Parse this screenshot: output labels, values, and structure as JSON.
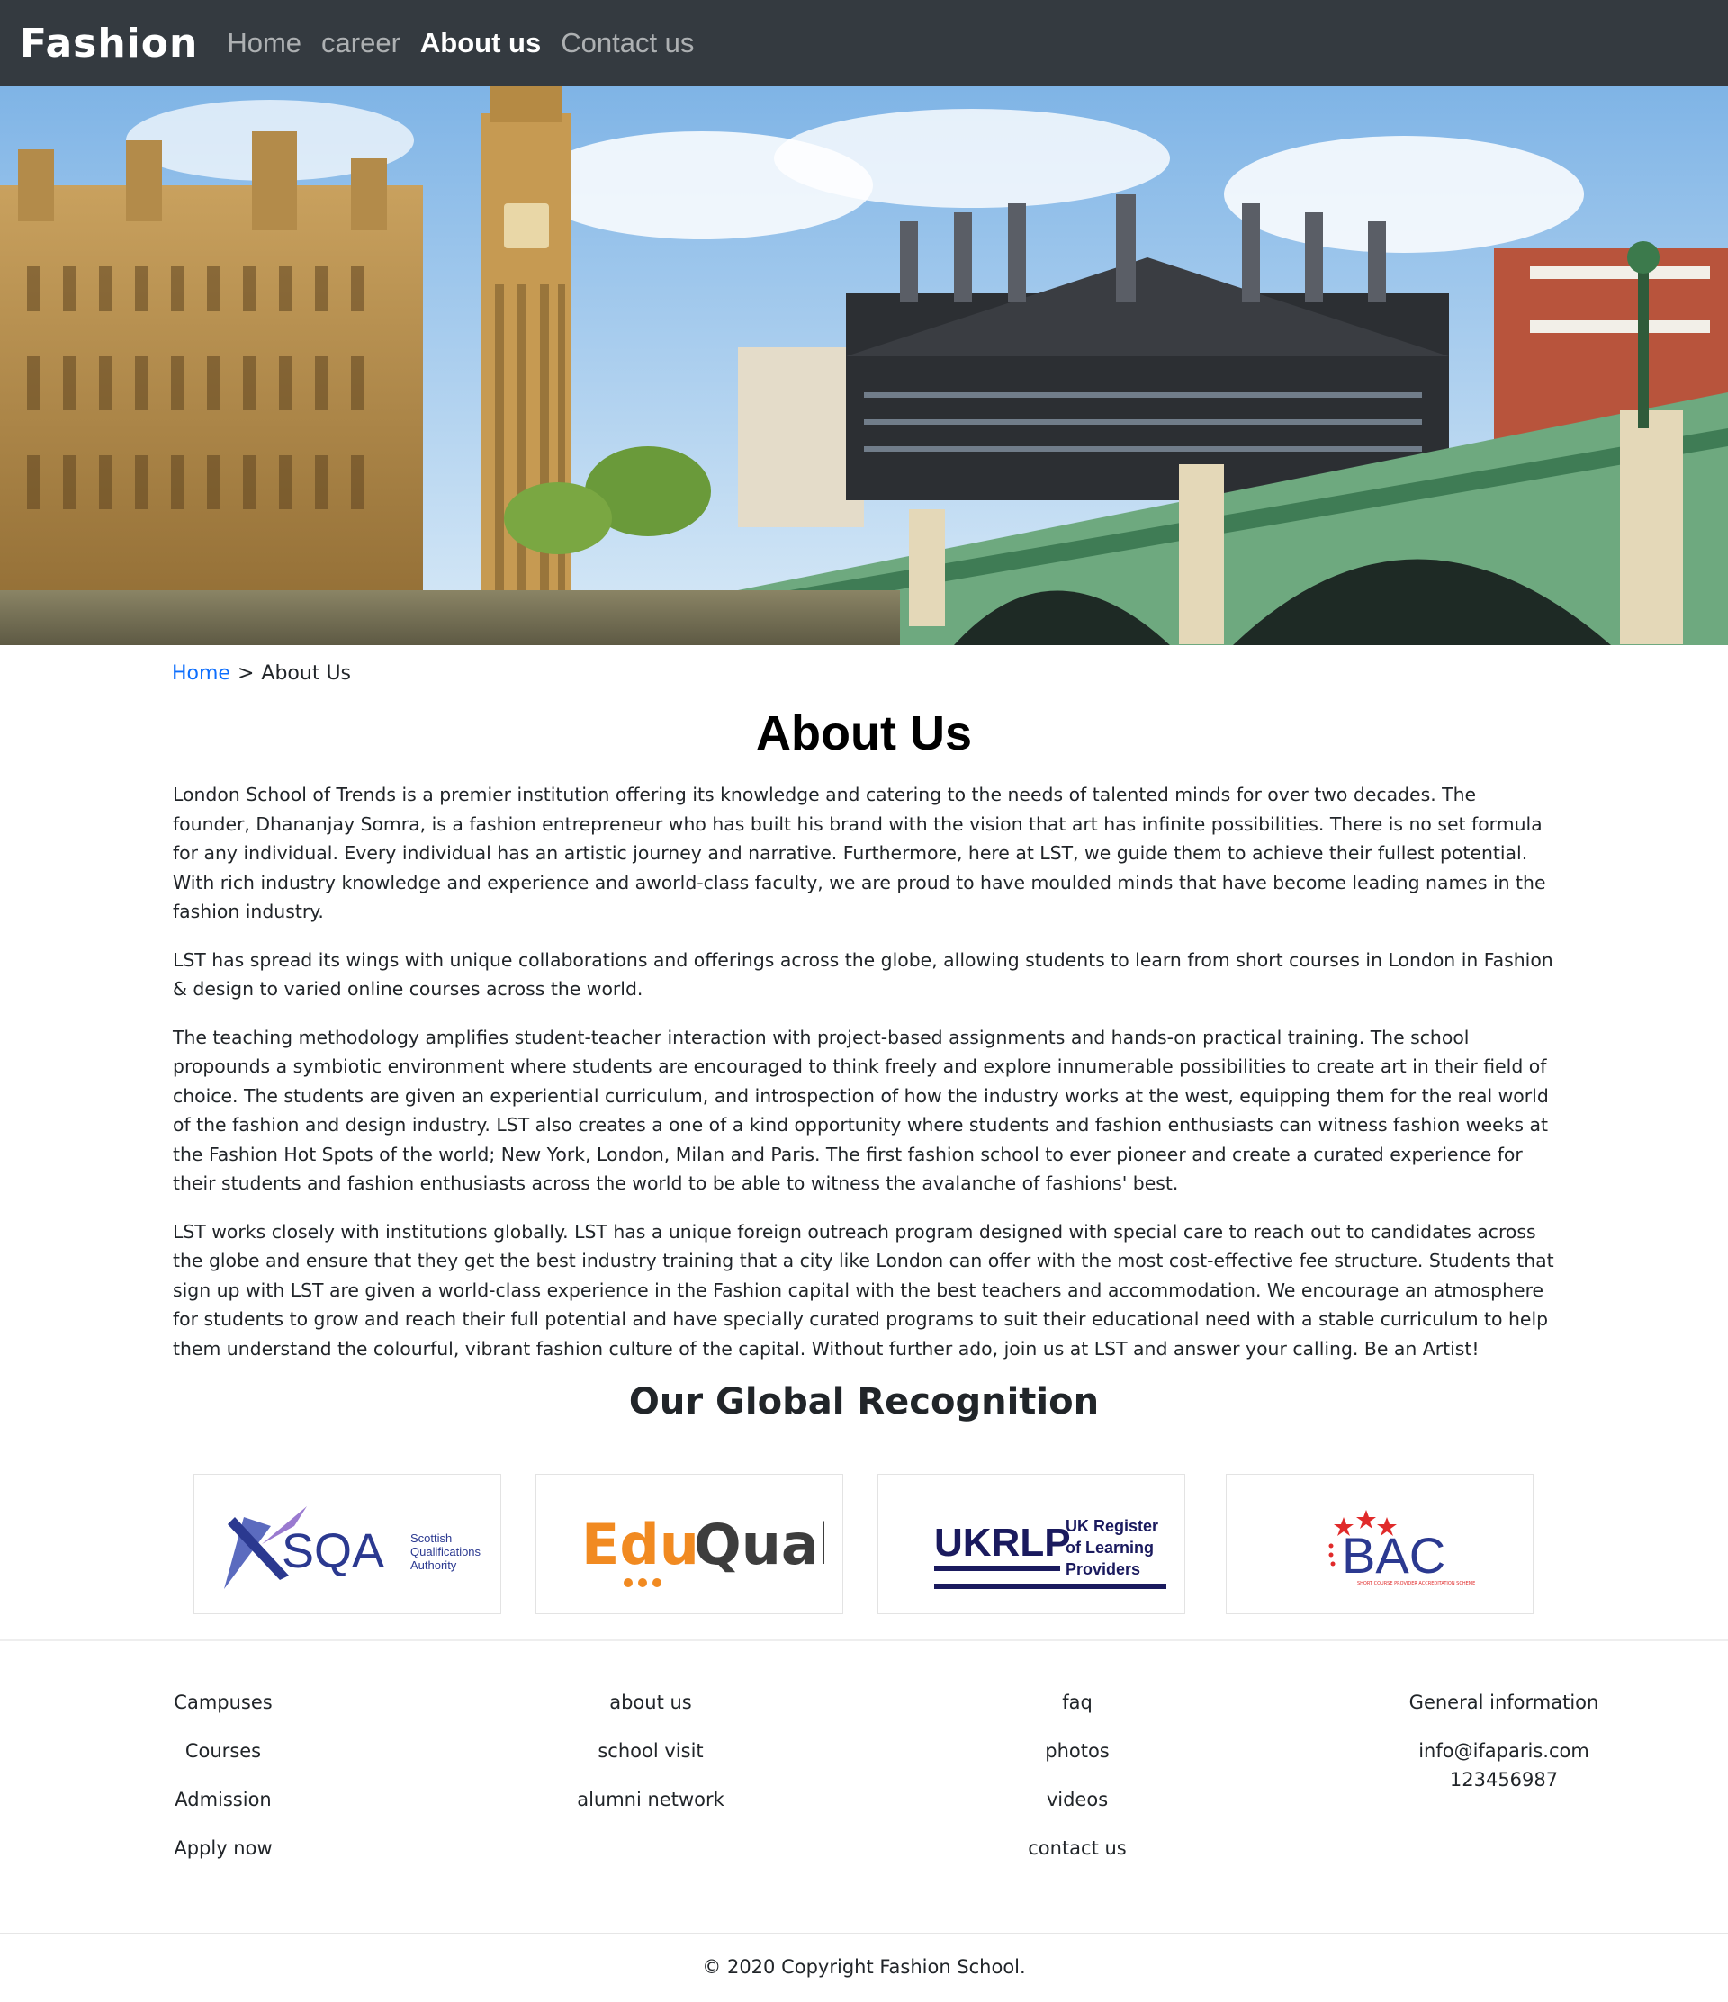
{
  "navbar": {
    "brand": "Fashion",
    "links": [
      "Home",
      "career",
      "About us",
      "Contact us"
    ],
    "active": "About us"
  },
  "breadcrumb": {
    "home": "Home",
    "separator": ">",
    "current": "About Us"
  },
  "page": {
    "title": "About Us",
    "paragraphs": [
      "London School of Trends is a premier institution offering its knowledge and catering to the needs of talented minds for over two decades. The founder, Dhananjay Somra, is a fashion entrepreneur who has built his brand with the vision that art has infinite possibilities. There is no set formula for any individual. Every individual has an artistic journey and narrative. Furthermore, here at LST, we guide them to achieve their fullest potential. With rich industry knowledge and experience and aworld-class faculty, we are proud to have moulded minds that have become leading names in the fashion industry.",
      "LST has spread its wings with unique collaborations and offerings across the globe, allowing students to learn from short courses in London in Fashion & design to varied online courses across the world.",
      "The teaching methodology amplifies student-teacher interaction with project-based assignments and hands-on practical training. The school propounds a symbiotic environment where students are encouraged to think freely and explore innumerable possibilities to create art in their field of choice. The students are given an experiential curriculum, and introspection of how the industry works at the west, equipping them for the real world of the fashion and design industry. LST also creates a one of a kind opportunity where students and fashion enthusiasts can witness fashion weeks at the Fashion Hot Spots of the world; New York, London, Milan and Paris. The first fashion school to ever pioneer and create a curated experience for their students and fashion enthusiasts across the world to be able to witness the avalanche of fashions' best.",
      "LST works closely with institutions globally. LST has a unique foreign outreach program designed with special care to reach out to candidates across the globe and ensure that they get the best industry training that a city like London can offer with the most cost-effective fee structure. Students that sign up with LST are given a world-class experience in the Fashion capital with the best teachers and accommodation. We encourage an atmosphere for students to grow and reach their full potential and have specially curated programs to suit their educational need with a stable curriculum to help them understand the colourful, vibrant fashion culture of the capital. Without further ado, join us at LST and answer your calling. Be an Artist!"
    ]
  },
  "recognition": {
    "title": "Our Global Recognition",
    "logos": {
      "sqa": {
        "mark": "SQA",
        "text1": "Scottish",
        "text2": "Qualifications",
        "text3": "Authority"
      },
      "eduqual": {
        "part1": "Edu",
        "part2": "Qual"
      },
      "ukrlp": {
        "mark": "UKRLP",
        "text1": "UK Register",
        "text2": "of Learning",
        "text3": "Providers"
      },
      "bac": {
        "mark": "BAC",
        "subtext": "SHORT COURSE PROVIDER ACCREDITATION SCHEME"
      }
    }
  },
  "footer": {
    "col1": [
      "Campuses",
      "Courses",
      "Admission",
      "Apply now"
    ],
    "col2": [
      "about us",
      "school visit",
      "alumni network"
    ],
    "col3": [
      "faq",
      "photos",
      "videos",
      "contact us"
    ],
    "col4": {
      "title": "General information",
      "email": "info@ifaparis.com",
      "phone": "123456987"
    },
    "copyright": "© 2020 Copyright Fashion School."
  },
  "colors": {
    "navbar_bg": "#343a40",
    "link_blue": "#0d6efd",
    "eduqual_orange": "#f18a21",
    "uk_navy": "#1a1a5e",
    "bac_blue": "#2b3990",
    "bac_red": "#e02a2a"
  }
}
